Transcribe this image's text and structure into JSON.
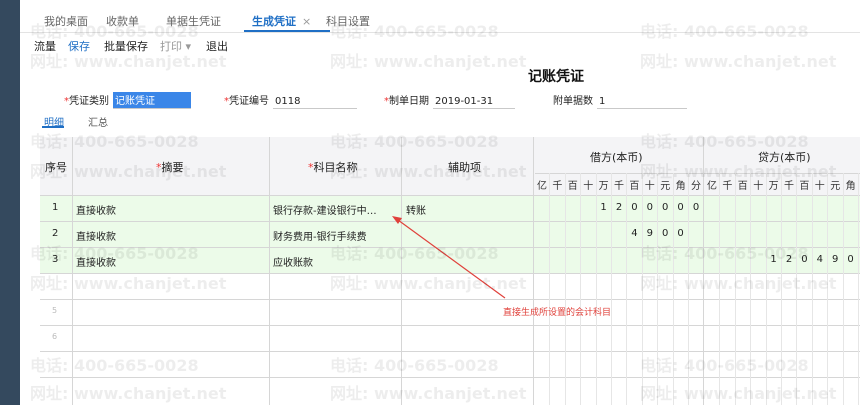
{
  "tabs": [
    {
      "label": "我的桌面"
    },
    {
      "label": "收款单"
    },
    {
      "label": "单据生凭证"
    },
    {
      "label": "生成凭证",
      "close": "×"
    },
    {
      "label": "科目设置"
    }
  ],
  "toolbar": {
    "flow": "流量",
    "save": "保存",
    "batch_save": "批量保存",
    "print": "打印 ▾",
    "exit": "退出"
  },
  "voucher": {
    "title": "记账凭证",
    "type_label": "凭证类别",
    "type_value": "记账凭证",
    "number_label": "凭证编号",
    "number_value": "0118",
    "date_label": "制单日期",
    "date_value": "2019-01-31",
    "attach_label": "附单据数",
    "attach_value": "1"
  },
  "subtabs": {
    "detail": "明细",
    "summary": "汇总"
  },
  "table": {
    "headers": {
      "seq": "序号",
      "summary": "摘要",
      "account": "科目名称",
      "aux": "辅助项",
      "debit": "借方(本币)",
      "credit": "贷方(本币)"
    },
    "debit_digits": [
      "亿",
      "千",
      "百",
      "十",
      "万",
      "千",
      "百",
      "十",
      "元",
      "角",
      "分"
    ],
    "credit_digits": [
      "亿",
      "千",
      "百",
      "十",
      "万",
      "千",
      "百",
      "十",
      "元",
      "角"
    ],
    "rows": [
      {
        "seq": "1",
        "summary": "直接收款",
        "account": "银行存款-建设银行中…",
        "aux": "转账",
        "debit": [
          "",
          "",
          "",
          "",
          "1",
          "2",
          "0",
          "0",
          "0",
          "0",
          "0"
        ],
        "credit": [
          "",
          "",
          "",
          "",
          "",
          "",
          "",
          "",
          "",
          ""
        ]
      },
      {
        "seq": "2",
        "summary": "直接收款",
        "account": "财务费用-银行手续费",
        "aux": "",
        "debit": [
          "",
          "",
          "",
          "",
          "",
          "",
          "4",
          "9",
          "0",
          "0",
          ""
        ],
        "credit": [
          "",
          "",
          "",
          "",
          "",
          "",
          "",
          "",
          "",
          ""
        ]
      },
      {
        "seq": "3",
        "summary": "直接收款",
        "account": "应收账款",
        "aux": "",
        "debit": [
          "",
          "",
          "",
          "",
          "",
          "",
          "",
          "",
          "",
          "",
          ""
        ],
        "credit": [
          "",
          "",
          "",
          "",
          "1",
          "2",
          "0",
          "4",
          "9",
          "0"
        ]
      }
    ],
    "empty_rows": [
      "5",
      "6"
    ]
  },
  "annotation": "直接生成所设置的会计科目",
  "watermark": {
    "phone": "电话: 400-665-0028",
    "site": "网址: www.chanjet.net"
  },
  "colors": {
    "accent": "#1f6fc5",
    "row_green": "#ecfbe9",
    "annotation": "#e0413b"
  }
}
